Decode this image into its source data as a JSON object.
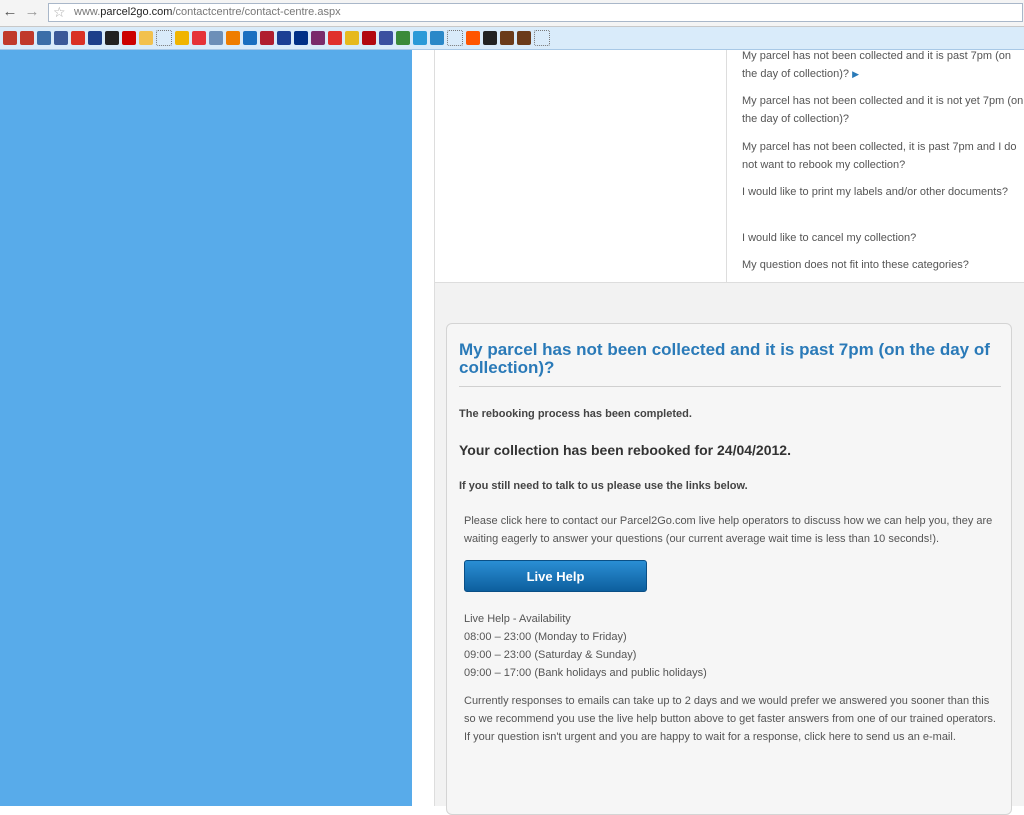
{
  "browser": {
    "url_prefix": "www.",
    "url_domain": "parcel2go.com",
    "url_path": "/contactcentre/contact-centre.aspx",
    "back_icon": "arrow-left-icon",
    "forward_icon": "arrow-right-icon",
    "star_icon": "star-icon",
    "bookmark_icons": [
      {
        "name": "bookmark-arrow-icon",
        "color": "#c0392b"
      },
      {
        "name": "bookmark-arrow-icon",
        "color": "#c0392b"
      },
      {
        "name": "bookmark-af-icon",
        "color": "#3b6ea8"
      },
      {
        "name": "facebook-icon",
        "color": "#3b5998"
      },
      {
        "name": "gmail-icon",
        "color": "#d93025"
      },
      {
        "name": "bookmark-hand-icon",
        "color": "#1d3f8a"
      },
      {
        "name": "bookmark-blackbox-icon",
        "color": "#222222"
      },
      {
        "name": "youtube-icon",
        "color": "#cc0000"
      },
      {
        "name": "bookmark-page-icon",
        "color": "#f2c14e"
      },
      {
        "name": "bookmark-blank-icon",
        "color": "#d9ebfa"
      },
      {
        "name": "bookmark-smiley-icon",
        "color": "#f0b400"
      },
      {
        "name": "ebay-icon",
        "color": "#e53238"
      },
      {
        "name": "bookmark-doc-icon",
        "color": "#6d8fb8"
      },
      {
        "name": "bookmark-orange-icon",
        "color": "#ef7d00"
      },
      {
        "name": "bookmark-blue-icon",
        "color": "#1a6fc0"
      },
      {
        "name": "bookmark-red-icon",
        "color": "#b01e2f"
      },
      {
        "name": "bookmark-ba-icon",
        "color": "#1c3f94"
      },
      {
        "name": "paypal-icon",
        "color": "#003087"
      },
      {
        "name": "bookmark-person-icon",
        "color": "#7a2b6b"
      },
      {
        "name": "bookmark-s-icon",
        "color": "#e0302c"
      },
      {
        "name": "imdb-icon",
        "color": "#e6b91e"
      },
      {
        "name": "netflix-icon",
        "color": "#b20710"
      },
      {
        "name": "bookmark-gem-icon",
        "color": "#3a50a0"
      },
      {
        "name": "bookmark-car-icon",
        "color": "#3a8a3a"
      },
      {
        "name": "bookmark-drop-icon",
        "color": "#2a9ad8"
      },
      {
        "name": "bookmark-check-icon",
        "color": "#2a88c8"
      },
      {
        "name": "bookmark-blank-icon",
        "color": "#d9ebfa"
      },
      {
        "name": "soundcloud-icon",
        "color": "#ff5500"
      },
      {
        "name": "bookmark-circle-icon",
        "color": "#222222"
      },
      {
        "name": "bookmark-brown-icon",
        "color": "#6b3b1a"
      },
      {
        "name": "bookmark-brown-icon",
        "color": "#6b3b1a"
      },
      {
        "name": "bookmark-blank-icon",
        "color": "#d9ebfa"
      }
    ]
  },
  "faq": {
    "items": [
      {
        "text": "My parcel has not been collected and it is past 7pm (on the day of collection)?",
        "active": true
      },
      {
        "text": "My parcel has not been collected and it is not yet 7pm (on the day of collection)?",
        "active": false
      },
      {
        "text": "My parcel has not been collected, it is past 7pm and I do not want to rebook my collection?",
        "active": false
      },
      {
        "text": "I would like to print my labels and/or other documents?",
        "active": false
      },
      {
        "text": "I would like to cancel my collection?",
        "active": false
      },
      {
        "text": "My question does not fit into these categories?",
        "active": false
      }
    ],
    "active_arrow": "▶"
  },
  "panel": {
    "title": "My parcel has not been collected and it is past 7pm (on the day of collection)?",
    "rebook_done": "The rebooking process has been completed.",
    "rebook_date": "Your collection has been rebooked for 24/04/2012.",
    "still_need": "If you still need to talk to us please use the links below.",
    "help_text": "Please click here to contact our Parcel2Go.com live help operators to discuss how we can help you, they are waiting eagerly to answer your questions (our current average wait time is less than 10 seconds!).",
    "live_help_label": "Live Help",
    "availability": [
      "Live Help - Availability",
      "08:00 – 23:00 (Monday to Friday)",
      "09:00 – 23:00 (Saturday & Sunday)",
      "09:00 – 17:00 (Bank holidays and public holidays)"
    ],
    "email_text": "Currently responses to emails can take up to 2 days and we would prefer we answered you sooner than this so we recommend you use the live help button above to get faster answers from one of our trained operators. If your question isn't urgent and you are happy to wait for a response, click here to send us an e-mail."
  },
  "colors": {
    "left_panel": "#58abea",
    "accent_blue": "#2a7ab8",
    "button_top": "#2a8ed4",
    "button_bottom": "#0d5f9e"
  }
}
